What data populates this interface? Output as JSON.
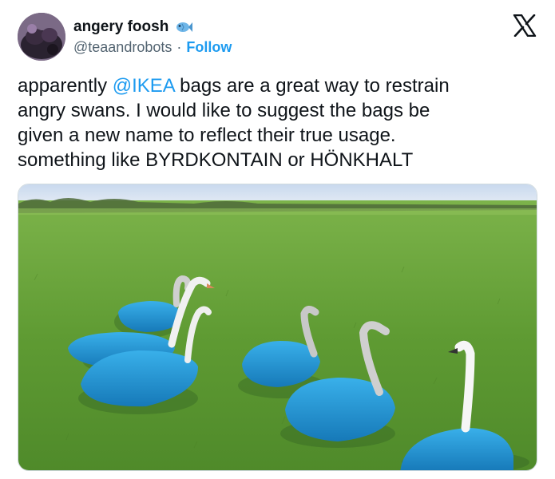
{
  "author": {
    "display_name": "angery foosh",
    "handle": "@teaandrobots",
    "separator": "·",
    "follow_label": "Follow",
    "badge_icon": "fish-icon"
  },
  "platform_icon": "x-logo-icon",
  "tweet": {
    "line1_prefix": "apparently ",
    "mention": "@IKEA",
    "line1_suffix": " bags are a great way to restrain\nangry swans. I would like to suggest the bags be\ngiven a new name to reflect their true usage.\nsomething like BYRDKONTAIN or HÖNKHALT"
  },
  "colors": {
    "link_blue": "#1d9bf0",
    "secondary_text": "#536471",
    "ikea_bag_blue": "#1f9ad6",
    "grass_green": "#5e9a34"
  }
}
